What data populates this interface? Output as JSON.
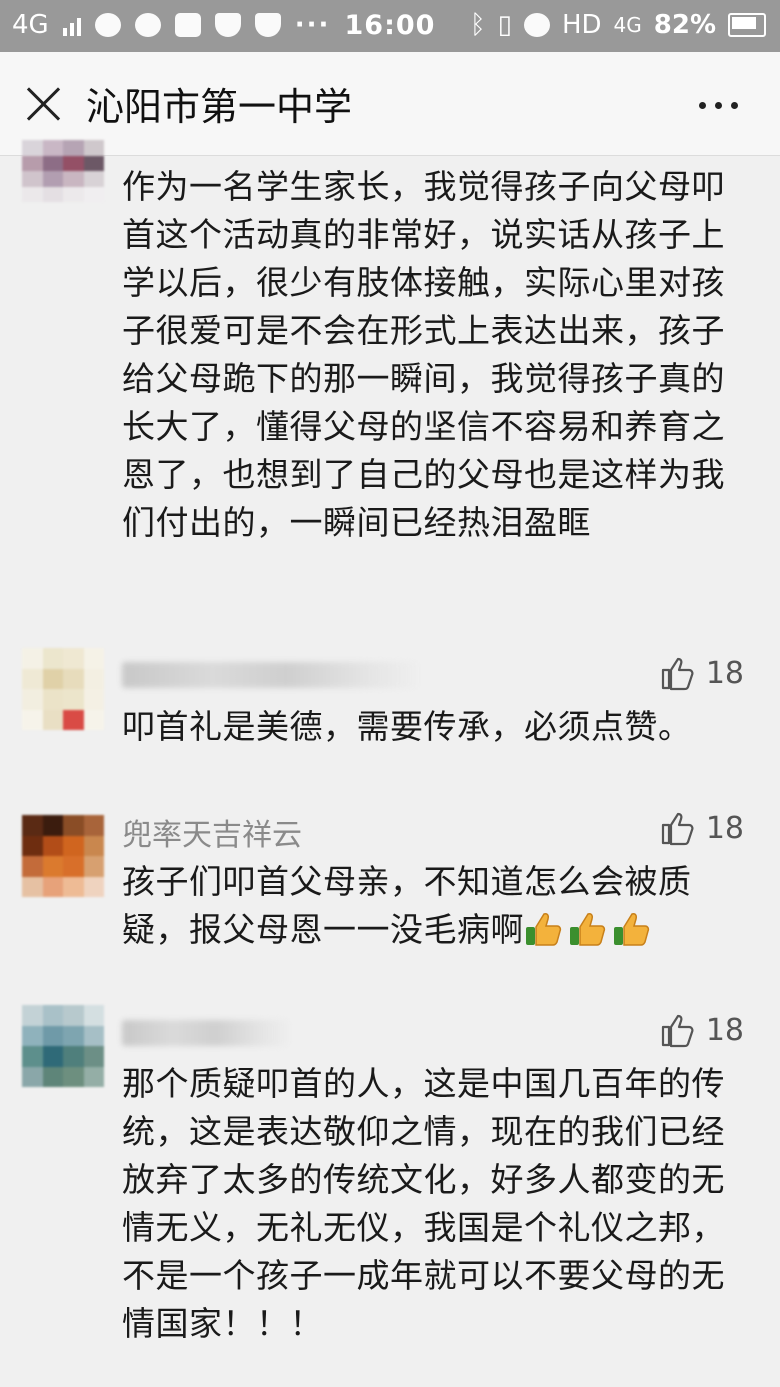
{
  "status_bar": {
    "network": "4G",
    "time": "16:00",
    "hd_label": "HD",
    "net2": "4G",
    "battery_percent": "82%"
  },
  "nav": {
    "title": "沁阳市第一中学"
  },
  "comments": [
    {
      "author": "",
      "likes": "",
      "text": "作为一名学生家长，我觉得孩子向父母叩首这个活动真的非常好，说实话从孩子上学以后，很少有肢体接触，实际心里对孩子很爱可是不会在形式上表达出来，孩子给父母跪下的那一瞬间，我觉得孩子真的长大了，懂得父母的坚信不容易和养育之恩了，也想到了自己的父母也是这样为我们付出的，一瞬间已经热泪盈眶"
    },
    {
      "author": "",
      "likes": "18",
      "text": "叩首礼是美德，需要传承，必须点赞。"
    },
    {
      "author": "兜率天吉祥云",
      "likes": "18",
      "text": "孩子们叩首父母亲，不知道怎么会被质疑，报父母恩一一没毛病啊",
      "emoji_count": 3
    },
    {
      "author": "",
      "likes": "18",
      "text": "那个质疑叩首的人，这是中国几百年的传统，这是表达敬仰之情，现在的我们已经放弃了太多的传统文化，好多人都变的无情无义，无礼无仪，我国是个礼仪之邦，不是一个孩子一成年就可以不要父母的无情国家！！！"
    }
  ],
  "colors": {
    "status_bar": "#999999",
    "nav_bg": "#f7f7f7",
    "page_bg": "#f0f0f0",
    "username": "#8a8a8a"
  }
}
